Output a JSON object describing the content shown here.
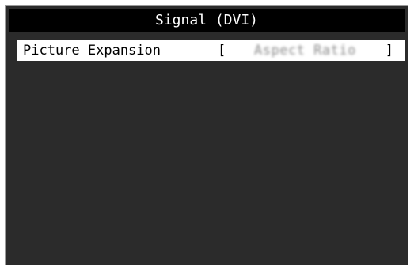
{
  "osd": {
    "title": "Signal (DVI)",
    "menu_items": [
      {
        "label": "Picture Expansion",
        "value": "Aspect Ratio",
        "bracket_open": "[",
        "bracket_close": "]"
      }
    ]
  },
  "colors": {
    "background": "#2b2b2b",
    "title_bar": "#000000",
    "title_text": "#ffffff",
    "selected_row": "#ffffff",
    "selected_text": "#000000"
  }
}
